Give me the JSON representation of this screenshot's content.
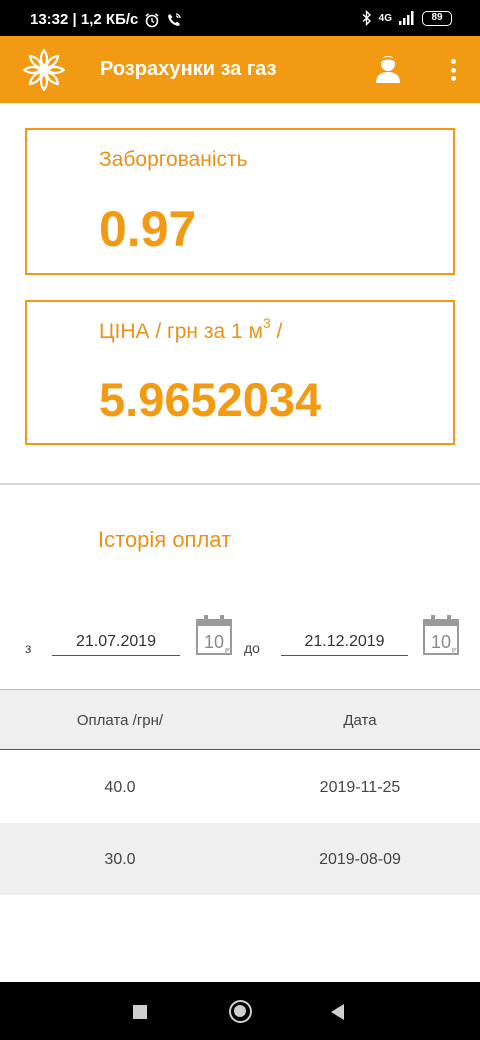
{
  "status_bar": {
    "time_speed": "13:32 | 1,2 КБ/с",
    "network": "4G",
    "battery": "89"
  },
  "app_bar": {
    "title": "Розрахунки за газ"
  },
  "debt_card": {
    "label": "Заборгованість",
    "value": "0.97"
  },
  "price_card": {
    "label": "ЦІНА / грн за 1 м",
    "label_sup": "3",
    "label_suffix": " /",
    "value": "5.9652034"
  },
  "history": {
    "title": "Історія оплат",
    "from_label": "з",
    "from_date": "21.07.2019",
    "to_label": "до",
    "to_date": "21.12.2019",
    "calendar_day": "10"
  },
  "table": {
    "headers": [
      "Оплата /грн/",
      "Дата"
    ],
    "rows": [
      {
        "amount": "40.0",
        "date": "2019-11-25"
      },
      {
        "amount": "30.0",
        "date": "2019-08-09"
      }
    ]
  },
  "colors": {
    "accent": "#f29a12",
    "accent_text": "#e8921a",
    "status_bar": "#000000"
  }
}
